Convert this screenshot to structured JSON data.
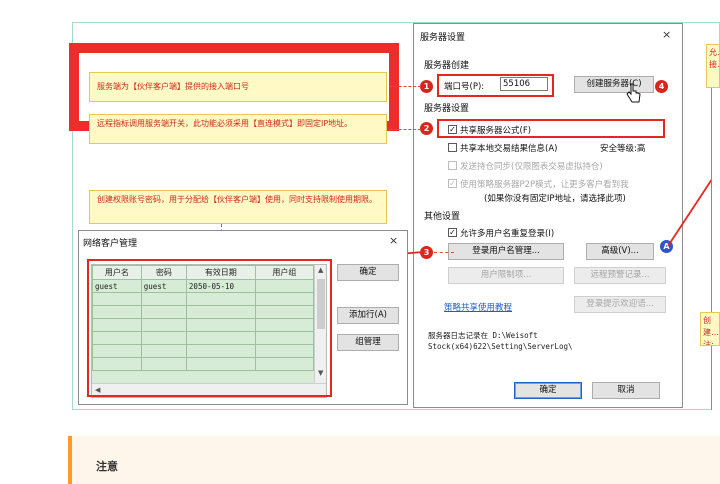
{
  "callouts": {
    "port": "服务端为【伙伴客户端】提供的接入端口号",
    "public": "远程指标调用服务端开关，此功能必须采用【直连模式】即固定IP地址。",
    "account": "创建权限账号密码，用于分配给【伙伴客户端】使用，同时支持限制使用期限。",
    "right_top": "允…接…",
    "right_bottom": "创建…注:录…"
  },
  "server_dialog": {
    "title": "服务器设置",
    "close": "×",
    "section_create": "服务器创建",
    "port_label": "端口号(P):",
    "port_value": "55106",
    "create_button": "创建服务器(C)",
    "section_settings": "服务器设置",
    "public_formula": "共享服务器公式(F)",
    "share_local": "共享本地交易结果信息(A)",
    "security_level": "安全等级:高",
    "send_position": "发送持仓同步(仅限图表交易虚拟持仓)",
    "p2p_mode": "使用策略服务器P2P模式，让更多客户看到我",
    "p2p_note": "(如果你没有固定IP地址，请选择此项)",
    "section_other": "其他设置",
    "allow_multi": "允许多用户名重复登录(I)",
    "login_user_button": "登录用户名管理...",
    "advanced_button": "高级(V)...",
    "user_limit_button": "用户限制项...",
    "remote_alert_button": "远程预警记录...",
    "tutorial_link": "策略共享使用教程",
    "welcome_button": "登录提示欢迎语...",
    "log_text": "服务器日志记录在 D:\\Weisoft Stock(x64)622\\Setting\\ServerLog\\",
    "ok_button": "确定",
    "cancel_button": "取消"
  },
  "client_dialog": {
    "title": "网络客户管理",
    "close": "×",
    "columns": [
      "用户名",
      "密码",
      "有效日期",
      "用户组"
    ],
    "rows": [
      [
        "guest",
        "guest",
        "2050-05-10",
        ""
      ]
    ],
    "ok_button": "确定",
    "add_row_button": "添加行(A)",
    "group_button": "组管理"
  },
  "badges": [
    "1",
    "2",
    "3",
    "4",
    "A"
  ],
  "notice": {
    "title": "注意"
  },
  "colors": {
    "accent_red": "#ec2d2a",
    "callout_bg": "#fff9c6",
    "notice_bar": "#ff9b2c",
    "grid_green": "#d6ecd6"
  }
}
